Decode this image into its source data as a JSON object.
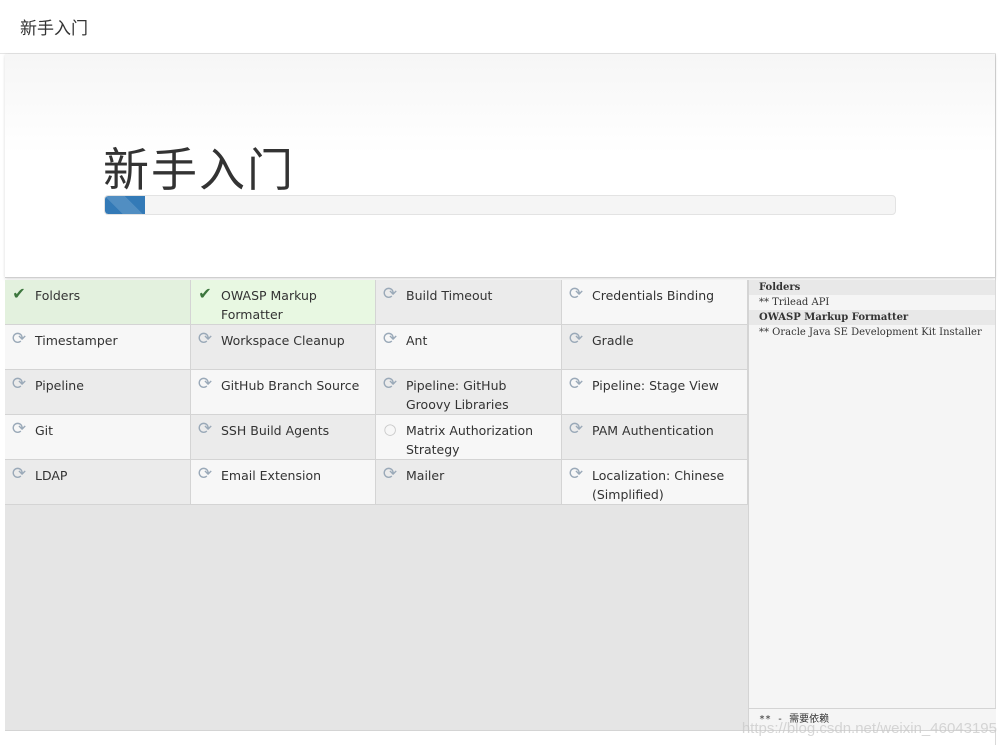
{
  "header": {
    "title": "新手入门"
  },
  "jumbotron": {
    "title": "新手入门",
    "progress_percent": 5
  },
  "plugins": [
    {
      "label": "Folders",
      "status": "success",
      "icon": "check-icon"
    },
    {
      "label": "OWASP Markup Formatter",
      "status": "success",
      "icon": "check-icon"
    },
    {
      "label": "Build Timeout",
      "status": "pending",
      "icon": "refresh-icon"
    },
    {
      "label": "Credentials Binding",
      "status": "pending",
      "icon": "refresh-icon"
    },
    {
      "label": "Timestamper",
      "status": "pending",
      "icon": "refresh-icon"
    },
    {
      "label": "Workspace Cleanup",
      "status": "pending",
      "icon": "refresh-icon"
    },
    {
      "label": "Ant",
      "status": "pending",
      "icon": "refresh-icon"
    },
    {
      "label": "Gradle",
      "status": "pending",
      "icon": "refresh-icon"
    },
    {
      "label": "Pipeline",
      "status": "installing",
      "icon": "refresh-icon"
    },
    {
      "label": "GitHub Branch Source",
      "status": "pending",
      "icon": "refresh-icon"
    },
    {
      "label": "Pipeline: GitHub Groovy Libraries",
      "status": "installing",
      "icon": "refresh-icon"
    },
    {
      "label": "Pipeline: Stage View",
      "status": "pending",
      "icon": "refresh-icon"
    },
    {
      "label": "Git",
      "status": "pending",
      "icon": "refresh-icon"
    },
    {
      "label": "SSH Build Agents",
      "status": "pending",
      "icon": "refresh-icon"
    },
    {
      "label": "Matrix Authorization Strategy",
      "status": "queued",
      "icon": "circle-icon"
    },
    {
      "label": "PAM Authentication",
      "status": "pending",
      "icon": "refresh-icon"
    },
    {
      "label": "LDAP",
      "status": "pending",
      "icon": "refresh-icon"
    },
    {
      "label": "Email Extension",
      "status": "pending",
      "icon": "refresh-icon"
    },
    {
      "label": "Mailer",
      "status": "pending",
      "icon": "refresh-icon"
    },
    {
      "label": "Localization: Chinese (Simplified)",
      "status": "pending",
      "icon": "refresh-icon"
    }
  ],
  "log": {
    "lines": [
      {
        "text": "Folders",
        "head": true
      },
      {
        "text": "** Trilead API",
        "head": false
      },
      {
        "text": "OWASP Markup Formatter",
        "head": true
      },
      {
        "text": "** Oracle Java SE Development Kit Installer",
        "head": false
      }
    ],
    "footer": "** - 需要依赖"
  },
  "watermark": "https://blog.csdn.net/weixin_46043195",
  "colors": {
    "success_bg": "#e3f1de",
    "check": "#3c763d",
    "progress": "#337ab7"
  }
}
